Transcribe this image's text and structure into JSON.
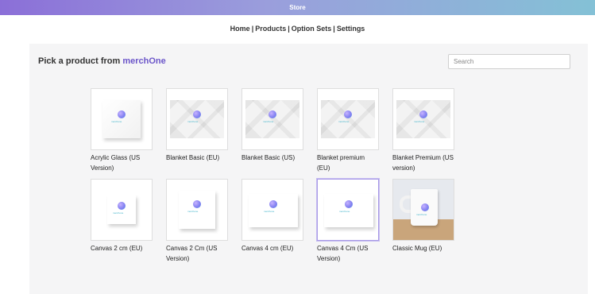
{
  "app": {
    "title": "Store"
  },
  "nav": {
    "items": [
      {
        "label": "Home"
      },
      {
        "label": "Products"
      },
      {
        "label": "Option Sets"
      },
      {
        "label": "Settings"
      }
    ],
    "separator": "|"
  },
  "main": {
    "heading_prefix": "Pick a product from",
    "brand": "merchOne",
    "search": {
      "placeholder": "Search",
      "value": ""
    }
  },
  "products": [
    {
      "name": "Acrylic Glass (US Version)",
      "image": "acrylic-glass-mockup"
    },
    {
      "name": "Blanket Basic (EU)",
      "image": "blanket-mockup"
    },
    {
      "name": "Blanket Basic (US)",
      "image": "blanket-mockup"
    },
    {
      "name": "Blanket premium (EU)",
      "image": "blanket-mockup"
    },
    {
      "name": "Blanket Premium (US version)",
      "image": "blanket-mockup"
    },
    {
      "name": "Canvas 2 cm (EU)",
      "image": "canvas-mockup"
    },
    {
      "name": "Canvas 2 Cm (US Version)",
      "image": "canvas-mockup"
    },
    {
      "name": "Canvas 4 cm (EU)",
      "image": "canvas-mockup"
    },
    {
      "name": "Canvas 4 Cm (US Version)",
      "image": "canvas-mockup",
      "selected": true
    },
    {
      "name": "Classic Mug (EU)",
      "image": "mug-mockup"
    }
  ],
  "colors": {
    "accent": "#6b55c9",
    "selected_border": "#a99be6"
  }
}
